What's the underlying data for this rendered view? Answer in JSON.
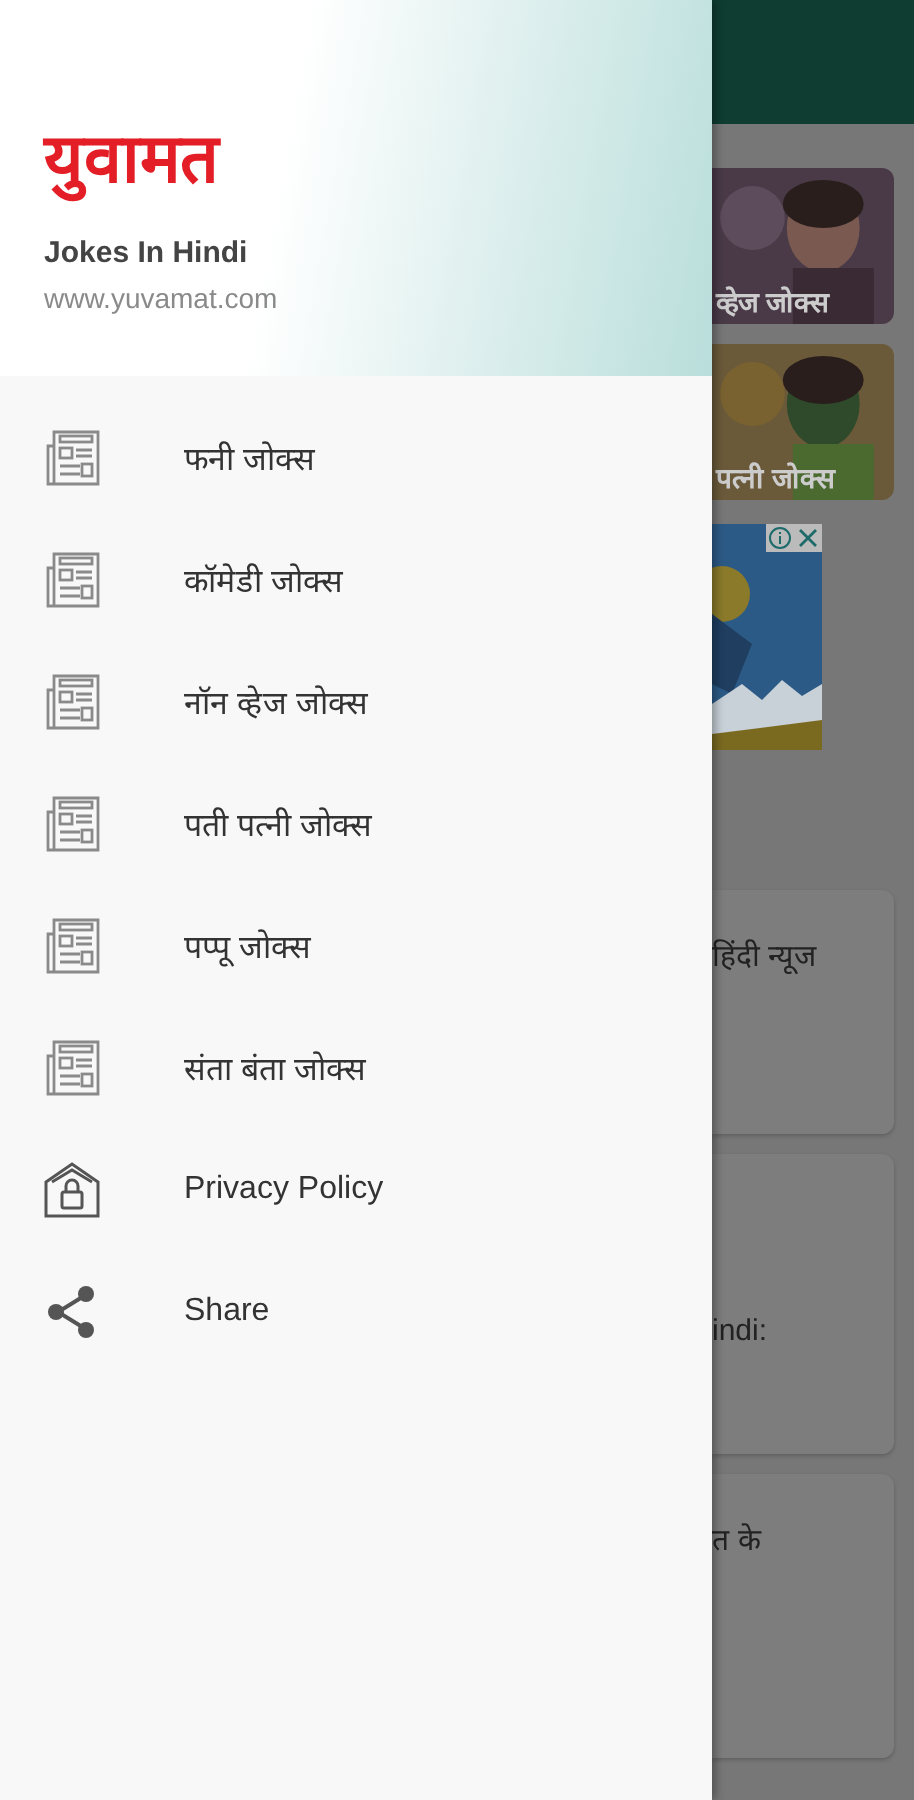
{
  "header": {
    "logo": "युवामत",
    "title": "Jokes In Hindi",
    "url": "www.yuvamat.com"
  },
  "menu": [
    {
      "label": "फनी जोक्स",
      "kind": "category"
    },
    {
      "label": "कॉमेडी जोक्स",
      "kind": "category"
    },
    {
      "label": "नॉन व्हेज जोक्स",
      "kind": "category"
    },
    {
      "label": "पती पत्नी जोक्स",
      "kind": "category"
    },
    {
      "label": "पप्पू जोक्स",
      "kind": "category"
    },
    {
      "label": "संता बंता जोक्स",
      "kind": "category"
    },
    {
      "label": "Privacy Policy",
      "kind": "privacy"
    },
    {
      "label": "Share",
      "kind": "share"
    }
  ],
  "background": {
    "picture_cards": [
      {
        "caption": "व्हेज जोक्स"
      },
      {
        "caption": "पत्नी जोक्स"
      }
    ],
    "news_cards": [
      {
        "title": "हिंदी न्यूज"
      },
      {
        "title": "indi:"
      },
      {
        "title": "त के"
      }
    ]
  }
}
